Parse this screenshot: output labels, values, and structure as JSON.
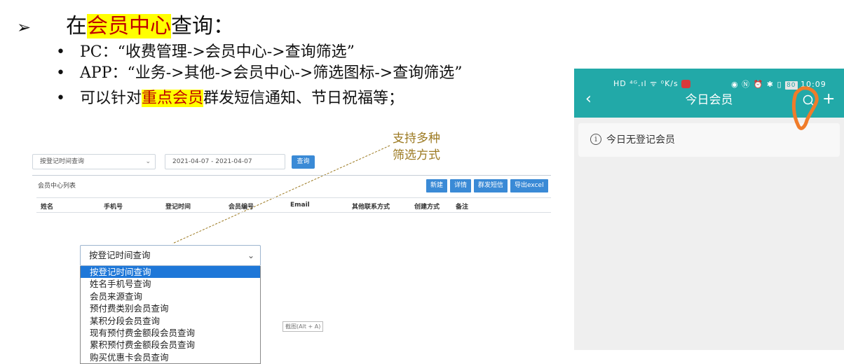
{
  "slide": {
    "title_prefix": "在",
    "title_highlight": "会员中心",
    "title_suffix": "查询：",
    "bullets": [
      "PC：“收费管理->会员中心->查询筛选”",
      "APP：“业务->其他->会员中心->筛选图标->查询筛选”"
    ],
    "bullet3_prefix": "可以针对",
    "bullet3_highlight": "重点会员",
    "bullet3_suffix": "群发短信通知、节日祝福等；",
    "annotation_line1": "支持多种",
    "annotation_line2": "筛选方式"
  },
  "pc": {
    "filter_select_value": "按登记时间查询",
    "date_range": "2021-04-07 - 2021-04-07",
    "query_button": "查询",
    "list_title": "会员中心列表",
    "actions": [
      "新建",
      "详情",
      "群发短信",
      "导出excel"
    ],
    "columns": [
      "姓名",
      "手机号",
      "登记时间",
      "会员编号",
      "Email",
      "其他联系方式",
      "创建方式",
      "备注"
    ],
    "screenshot_tip": "截图(Alt + A)",
    "dropdown": {
      "current": "按登记时间查询",
      "options": [
        "按登记时间查询",
        "姓名手机号查询",
        "会员来源查询",
        "预付费类别会员查询",
        "某积分段会员查询",
        "现有预付费金额段会员查询",
        "累积预付费金额段会员查询",
        "购买优惠卡会员查询"
      ],
      "selected_index": 0
    }
  },
  "app": {
    "status_left": "HD ⁴ᴳ.ıl ᯤ ⁰K/s",
    "status_right_icons": "◉ Ⓝ ⏰ ✱ ▯",
    "battery": "80",
    "time": "10:09",
    "title": "今日会员",
    "notice": "今日无登记会员"
  },
  "colors": {
    "highlight_bg": "#ffff00",
    "highlight_text": "#c00000",
    "app_bar": "#22a9a8",
    "pc_button": "#3a8ad6",
    "annotation": "#9c7a22",
    "hand_circle": "#f07c2a"
  }
}
